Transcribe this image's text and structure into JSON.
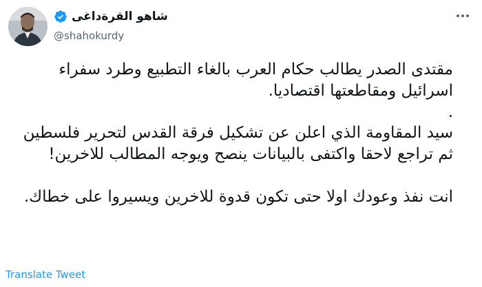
{
  "author": {
    "display_name": "شاهو القرةداغى",
    "handle": "@shahokurdy",
    "verified": true
  },
  "tweet": {
    "paragraphs": [
      "مقتدى الصدر يطالب حكام العرب بالغاء التطبيع وطرد سفراء اسرائيل ومقاطعتها اقتصاديا.",
      ".",
      "سيد المقاومة الذي اعلن عن تشكيل فرقة القدس لتحرير فلسطين ثم تراجع لاحقا واكتفى بالبيانات ينصح ويوجه المطالب للاخرين!",
      "",
      "انت نفذ وعودك اولا حتى تكون قدوة للاخرين ويسيروا على خطاك."
    ],
    "translate_label": "Translate Tweet"
  },
  "colors": {
    "text": "#0f1419",
    "secondary": "#536471",
    "accent": "#1d9bf0"
  },
  "icons": {
    "verified": "verified-badge-icon",
    "more": "more-options-icon"
  }
}
